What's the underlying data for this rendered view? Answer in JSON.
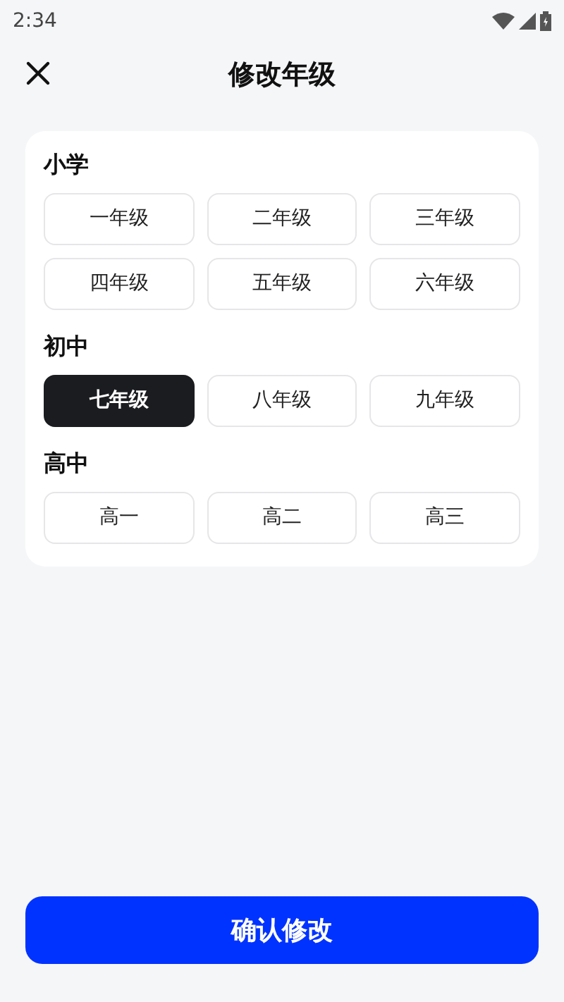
{
  "status_bar": {
    "time": "2:34"
  },
  "header": {
    "title": "修改年级"
  },
  "sections": [
    {
      "title": "小学",
      "options": [
        {
          "label": "一年级",
          "selected": false
        },
        {
          "label": "二年级",
          "selected": false
        },
        {
          "label": "三年级",
          "selected": false
        },
        {
          "label": "四年级",
          "selected": false
        },
        {
          "label": "五年级",
          "selected": false
        },
        {
          "label": "六年级",
          "selected": false
        }
      ]
    },
    {
      "title": "初中",
      "options": [
        {
          "label": "七年级",
          "selected": true
        },
        {
          "label": "八年级",
          "selected": false
        },
        {
          "label": "九年级",
          "selected": false
        }
      ]
    },
    {
      "title": "高中",
      "options": [
        {
          "label": "高一",
          "selected": false
        },
        {
          "label": "高二",
          "selected": false
        },
        {
          "label": "高三",
          "selected": false
        }
      ]
    }
  ],
  "confirm_button": "确认修改"
}
